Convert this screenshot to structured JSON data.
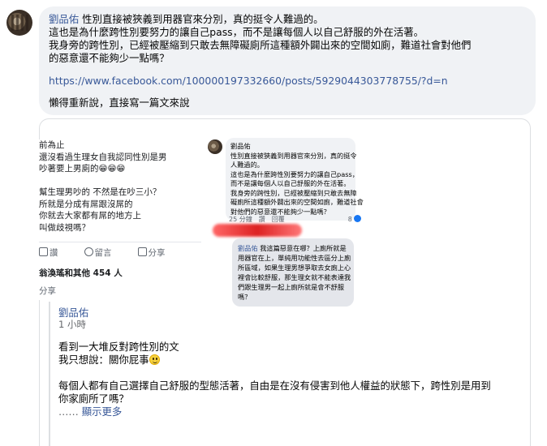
{
  "post": {
    "author": "劉品佑",
    "lines": [
      "性別直接被狹義到用器官來分別，真的挺令人難過的。",
      "這也是為什麼跨性別要努力的讓自己pass，而不是讓每個人以自己舒服的外在活著。",
      "我身旁的跨性別，已經被壓縮到只敢去無障礙廁所這種額外闢出來的空間如廁，難道社會對他們",
      "的惡意還不能夠少一點嗎？"
    ],
    "link": "https://www.facebook.com/100000197332660/posts/5929044303778755/?d=n",
    "lazy": "懶得重新說，直接寫一篇文來說"
  },
  "left_screenshot": {
    "lines": [
      "前為止",
      "還沒看過生理女自我認同性別是男",
      "吵著要上男廁的😁😁😁",
      "",
      "幫生理男吵的 不然是在吵三小？",
      "所就是分成有屌跟沒屌的",
      "你就去大家都有屌的地方上",
      "叫做歧視嗎？"
    ],
    "like_label": "讚",
    "comment_label": "留言",
    "share_label": "分享",
    "likes": "翁渙瑤和其他 454 人",
    "share_bottom": "分享"
  },
  "mid_screenshot": {
    "author": "劉品佑",
    "lines": [
      "性別直接被狹義到用器官來分別，真的挺令",
      "人難過的。",
      "這也是為什麼跨性別要努力的讓自己pass，",
      "而不是讓每個人以自己舒服的外在活著。",
      "我身旁的跨性別，已經被壓縮到只敢去無障",
      "礙廁所這種額外闢出來的空間如廁，難道社會",
      "對他們的惡意還不能夠少一點嗎？"
    ],
    "meta_time": "25 分鐘",
    "meta_like": "讚",
    "meta_reply": "回覆",
    "meta_count": "8",
    "reply_name": "劉品佑",
    "reply_lines": [
      "我這篇惡意在哪？上廁所就是",
      "用器官在上，單純用功能性去區分上廁",
      "所區域，如果生理男想爭取去女廁上心",
      "裡會比較舒服，那生理女就不能表達我",
      "們跟生理男一起上廁所就是會不舒服",
      "嗎？"
    ]
  },
  "reply": {
    "author": "劉品佑",
    "time": "1 小時",
    "line1": "看到一大堆反對跨性別的文",
    "line2": "我只想說：關你屁事",
    "line3": "每個人都有自己選擇自己舒服的型態活著，自由是在沒有侵害到他人權益的狀態下，跨性別是用到",
    "line4": "你家廁所了嗎？",
    "dots": "……",
    "more": "顯示更多"
  }
}
